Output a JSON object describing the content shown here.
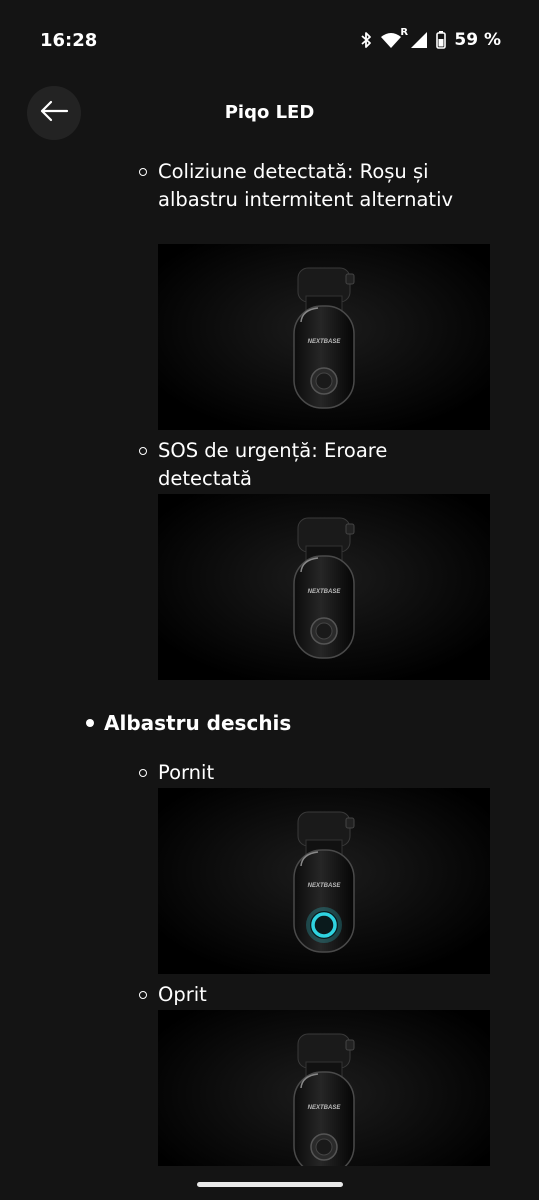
{
  "status": {
    "time": "16:28",
    "battery": "59 %",
    "network_badge": "R",
    "icons": [
      "bluetooth-icon",
      "wifi-icon",
      "signal-icon",
      "battery-icon"
    ]
  },
  "header": {
    "title": "Piqo LED",
    "back_icon": "arrow-left-icon"
  },
  "items": [
    {
      "type": "sub",
      "label": "Coliziune detectată: Roșu și albastru intermitent alternativ",
      "image": "dashcam-photo",
      "led_glow": false
    },
    {
      "type": "sub",
      "label": "SOS de urgență: Eroare detectată",
      "image": "dashcam-photo",
      "led_glow": false
    },
    {
      "type": "bullet",
      "label": "Albastru deschis"
    },
    {
      "type": "sub",
      "label": "Pornit",
      "image": "dashcam-photo",
      "led_glow": true
    },
    {
      "type": "sub",
      "label": "Oprit",
      "image": "dashcam-photo",
      "led_glow": false
    }
  ],
  "brand_text": "NEXTBASE",
  "colors": {
    "background": "#141414",
    "led_glow": "#2fd3e0"
  }
}
